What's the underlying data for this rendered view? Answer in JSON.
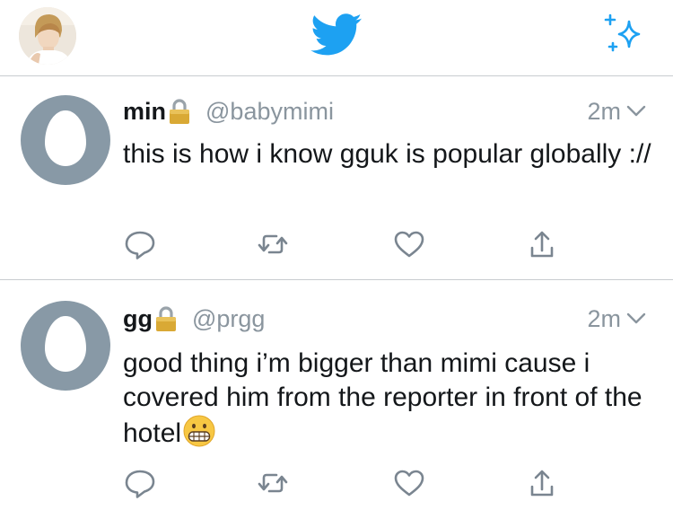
{
  "topbar": {
    "avatar_icon": "profile-avatar",
    "logo_icon": "twitter-bird-icon",
    "sparkle_icon": "sparkle-icon",
    "brand_color": "#1da1f2"
  },
  "tweets": [
    {
      "name": "min",
      "handle": "@babymimi",
      "time": "2m",
      "protected": true,
      "text": "this is how i know gguk is popular globally ://"
    },
    {
      "name": "gg",
      "handle": "@prgg",
      "time": "2m",
      "protected": true,
      "text": "good thing i’m bigger than mimi cause i covered him from the reporter in front of the hotel",
      "trailing_emoji": "grimacing-face"
    }
  ],
  "actions": [
    "reply-icon",
    "retweet-icon",
    "like-icon",
    "share-icon"
  ],
  "colors": {
    "text": "#14171a",
    "secondary": "#8a959e",
    "divider": "#c8ccd0",
    "avatar_bg": "#8899a6",
    "action_icon": "#7a8590"
  }
}
